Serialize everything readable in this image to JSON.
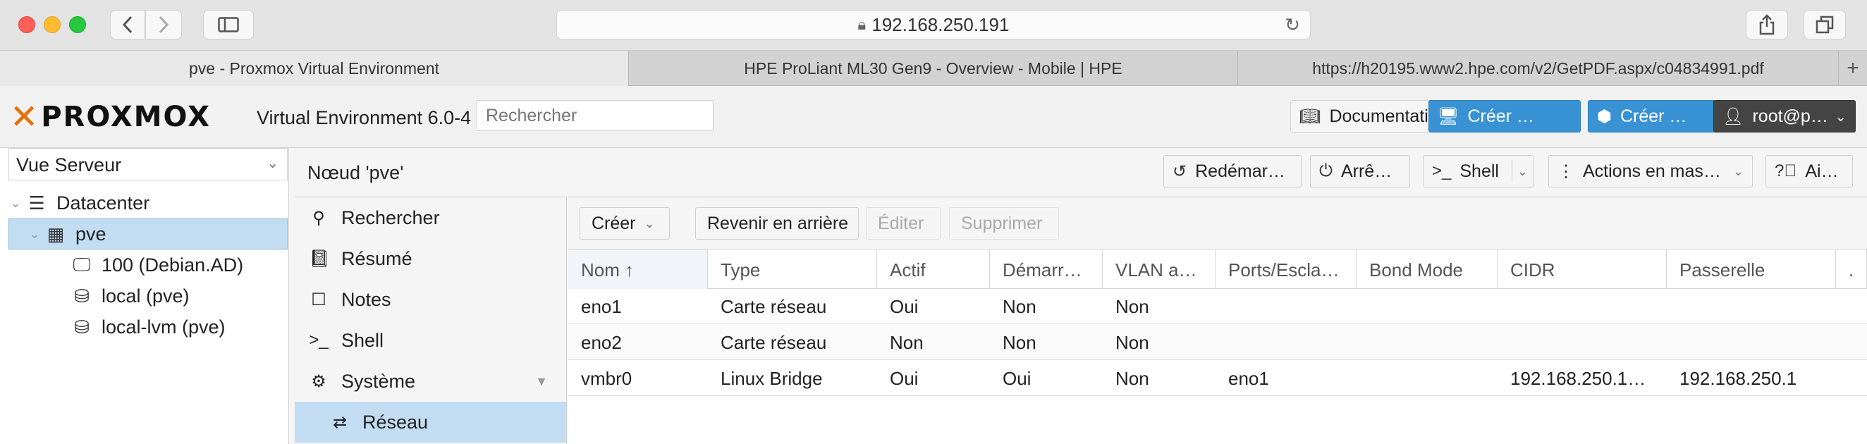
{
  "browser": {
    "url": "192.168.250.191",
    "tabs": [
      {
        "label": "pve - Proxmox Virtual Environment"
      },
      {
        "label": "HPE ProLiant ML30 Gen9 - Overview - Mobile | HPE"
      },
      {
        "label": "https://h20195.www2.hpe.com/v2/GetPDF.aspx/c04834991.pdf"
      }
    ],
    "new_tab_label": "+"
  },
  "header": {
    "logo_text": "PROXMOX",
    "version": "Virtual Environment 6.0-4",
    "search_placeholder": "Rechercher",
    "documentation_label": "Documentati…",
    "create_vm_label": "Créer …",
    "create_ct_label": "Créer …",
    "user_label": "root@p…"
  },
  "tree": {
    "view_select": "Vue Serveur",
    "items": [
      {
        "label": "Datacenter",
        "icon": "datacenter-icon"
      },
      {
        "label": "pve",
        "icon": "server-icon"
      },
      {
        "label": "100 (Debian.AD)",
        "icon": "vm-icon"
      },
      {
        "label": "local (pve)",
        "icon": "storage-icon"
      },
      {
        "label": "local-lvm (pve)",
        "icon": "storage-icon"
      }
    ]
  },
  "node": {
    "title": "Nœud 'pve'",
    "toolbar": {
      "reboot": "Redémar…",
      "shutdown": "Arrê…",
      "shell": "Shell",
      "bulk": "Actions en mas…",
      "help": "Ai…"
    },
    "menu": [
      {
        "label": "Rechercher",
        "icon": "search-icon"
      },
      {
        "label": "Résumé",
        "icon": "book-icon"
      },
      {
        "label": "Notes",
        "icon": "note-icon"
      },
      {
        "label": "Shell",
        "icon": "terminal-icon"
      },
      {
        "label": "Système",
        "icon": "cogs-icon"
      },
      {
        "label": "Réseau",
        "icon": "exchange-icon"
      }
    ]
  },
  "network": {
    "toolbar": {
      "create": "Créer",
      "revert": "Revenir en arrière",
      "edit": "Éditer",
      "delete": "Supprimer"
    },
    "columns": [
      "Nom ↑",
      "Type",
      "Actif",
      "Démarr…",
      "VLAN a…",
      "Ports/Escla…",
      "Bond Mode",
      "CIDR",
      "Passerelle",
      "."
    ],
    "rows": [
      [
        "eno1",
        "Carte réseau",
        "Oui",
        "Non",
        "Non",
        "",
        "",
        "",
        "",
        ""
      ],
      [
        "eno2",
        "Carte réseau",
        "Non",
        "Non",
        "Non",
        "",
        "",
        "",
        "",
        ""
      ],
      [
        "vmbr0",
        "Linux Bridge",
        "Oui",
        "Oui",
        "Non",
        "eno1",
        "",
        "192.168.250.1…",
        "192.168.250.1",
        ""
      ]
    ]
  }
}
